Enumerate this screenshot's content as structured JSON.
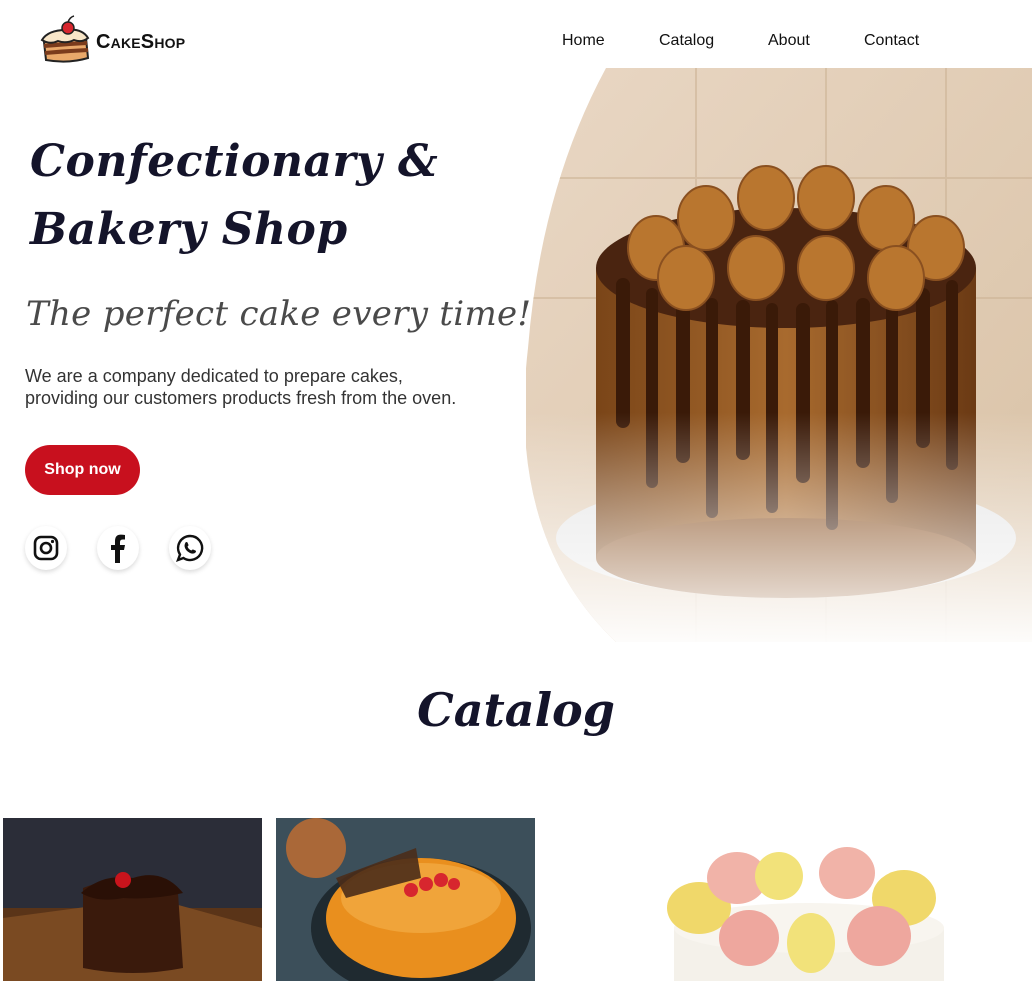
{
  "header": {
    "brand": "CakeShop",
    "nav": {
      "home": "Home",
      "catalog": "Catalog",
      "about": "About",
      "contact": "Contact"
    }
  },
  "hero": {
    "title_line1": "Confectionary &",
    "title_line2": "Bakery Shop",
    "subtitle": "The perfect cake every time!",
    "description_line1": "We are a company dedicated to prepare cakes,",
    "description_line2": "providing our customers products fresh from the oven.",
    "cta_label": "Shop now",
    "cta_color": "#c8101e",
    "socials": [
      "instagram-icon",
      "facebook-icon",
      "whatsapp-icon"
    ]
  },
  "catalog": {
    "title": "Catalog",
    "items": [
      "chocolate-cake-slice",
      "orange-mousse-cake",
      "macaron-cake"
    ]
  }
}
